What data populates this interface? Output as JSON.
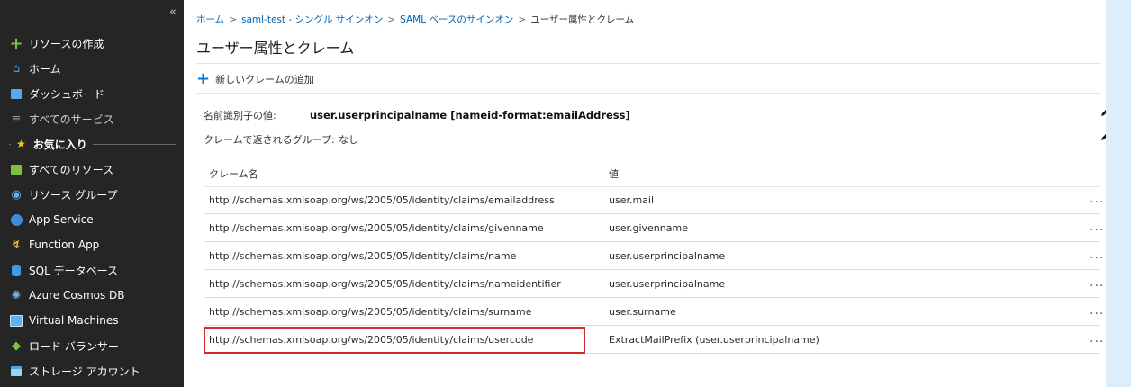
{
  "sidebar": {
    "collapse_icon": "«",
    "create_resource": "リソースの作成",
    "items_top": [
      {
        "label": "ホーム",
        "icon": "home-icon"
      },
      {
        "label": "ダッシュボード",
        "icon": "dashboard-icon"
      },
      {
        "label": "すべてのサービス",
        "icon": "list-icon"
      }
    ],
    "favorites_label": "お気に入り",
    "items_fav": [
      {
        "label": "すべてのリソース",
        "icon": "grid-icon"
      },
      {
        "label": "リソース グループ",
        "icon": "resource-group-icon"
      },
      {
        "label": "App Service",
        "icon": "app-service-icon"
      },
      {
        "label": "Function App",
        "icon": "function-app-icon"
      },
      {
        "label": "SQL データベース",
        "icon": "sql-database-icon"
      },
      {
        "label": "Azure Cosmos DB",
        "icon": "cosmos-db-icon"
      },
      {
        "label": "Virtual Machines",
        "icon": "virtual-machines-icon"
      },
      {
        "label": "ロード バランサー",
        "icon": "load-balancer-icon"
      },
      {
        "label": "ストレージ アカウント",
        "icon": "storage-account-icon"
      }
    ]
  },
  "breadcrumb": {
    "items": [
      "ホーム",
      "saml-test - シングル サインオン",
      "SAML ベースのサインオン"
    ],
    "current": "ユーザー属性とクレーム",
    "separator": ">"
  },
  "page": {
    "title": "ユーザー属性とクレーム",
    "add_claim": "新しいクレームの追加",
    "nameid_label": "名前識別子の値:",
    "nameid_value": "user.userprincipalname [nameid-format:emailAddress]",
    "groups_label": "クレームで返されるグループ:",
    "groups_value": "なし"
  },
  "table": {
    "headers": [
      "クレーム名",
      "値"
    ],
    "more_label": "...",
    "rows": [
      {
        "name": "http://schemas.xmlsoap.org/ws/2005/05/identity/claims/emailaddress",
        "value": "user.mail"
      },
      {
        "name": "http://schemas.xmlsoap.org/ws/2005/05/identity/claims/givenname",
        "value": "user.givenname"
      },
      {
        "name": "http://schemas.xmlsoap.org/ws/2005/05/identity/claims/name",
        "value": "user.userprincipalname"
      },
      {
        "name": "http://schemas.xmlsoap.org/ws/2005/05/identity/claims/nameidentifier",
        "value": "user.userprincipalname"
      },
      {
        "name": "http://schemas.xmlsoap.org/ws/2005/05/identity/claims/surname",
        "value": "user.surname"
      },
      {
        "name": "http://schemas.xmlsoap.org/ws/2005/05/identity/claims/usercode",
        "value": "ExtractMailPrefix (user.userprincipalname)"
      }
    ],
    "highlighted_row": 5
  },
  "colors": {
    "sidebar_bg": "#252526",
    "accent": "#0078d4",
    "highlight": "#d42a2a"
  }
}
